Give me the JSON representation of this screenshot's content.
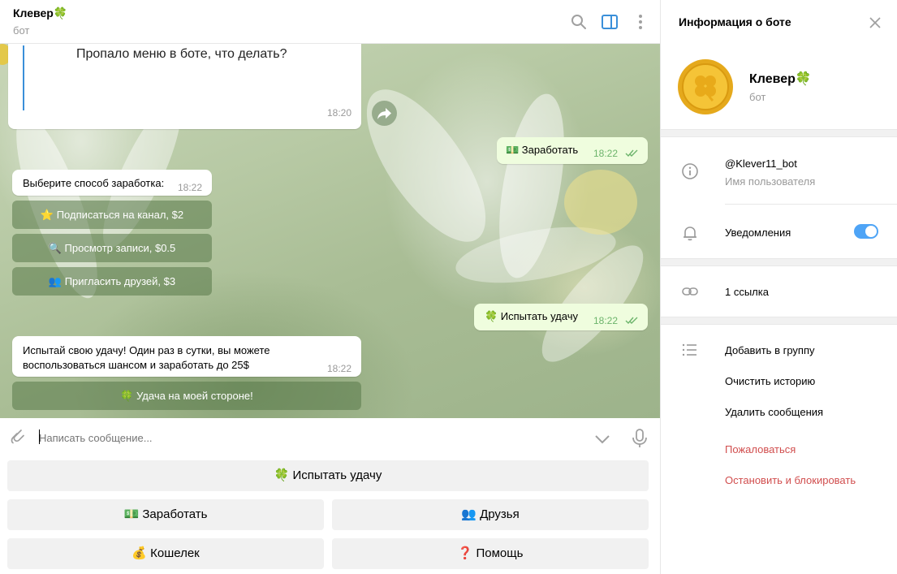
{
  "chat": {
    "title": "Клевер🍀",
    "subtitle": "бот",
    "icons": [
      "search-icon",
      "sidebar-toggle-icon",
      "more-vertical-icon"
    ]
  },
  "messages": [
    {
      "text": "Пропало меню в боте, что делать?",
      "time": "18:20",
      "direction": "in"
    },
    {
      "text": "💵 Заработать",
      "time": "18:22",
      "direction": "out"
    },
    {
      "text": "Выберите способ заработка:",
      "time": "18:22",
      "direction": "in",
      "buttons": [
        "⭐ Подписаться на канал, $2",
        "🔍 Просмотр записи, $0.5",
        "👥 Пригласить друзей, $3"
      ]
    },
    {
      "text": "🍀 Испытать удачу",
      "time": "18:22",
      "direction": "out"
    },
    {
      "text_line1": "Испытай свою удачу! Один раз в сутки, вы можете",
      "text_line2": "воспользоваться шансом и заработать до 25$",
      "time": "18:22",
      "direction": "in",
      "buttons": [
        "🍀 Удача на моей стороне!"
      ]
    }
  ],
  "input": {
    "placeholder": "Написать сообщение..."
  },
  "keyboard": {
    "row1": [
      "🍀 Испытать удачу"
    ],
    "row2": [
      "💵 Заработать",
      "👥 Друзья"
    ],
    "row3": [
      "💰 Кошелек",
      "❓ Помощь"
    ]
  },
  "panel": {
    "title": "Информация о боте",
    "name": "Клевер🍀",
    "subtitle": "бот",
    "username": "@Klever11_bot",
    "username_label": "Имя пользователя",
    "notifications": "Уведомления",
    "notifications_on": true,
    "links": "1 ссылка",
    "actions": [
      "Добавить в группу",
      "Очистить историю",
      "Удалить сообщения"
    ],
    "danger_actions": [
      "Пожаловаться",
      "Остановить и блокировать"
    ],
    "accent_color": "#4ea4f6",
    "danger_color": "#d14e4e"
  }
}
